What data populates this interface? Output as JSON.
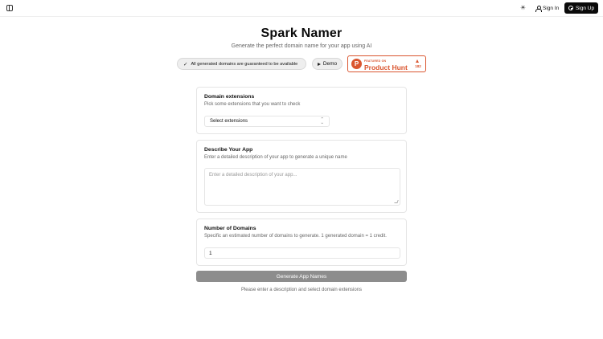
{
  "header": {
    "signin_label": "Sign In",
    "signup_label": "Sign Up",
    "icons": {
      "sidebar": "sidebar-toggle-icon",
      "theme": "sun-icon",
      "user": "user-icon",
      "signup": "plus-circle-icon"
    }
  },
  "hero": {
    "title": "Spark Namer",
    "subtitle": "Generate the perfect domain name for your app using AI"
  },
  "badges": {
    "availability": "All generated domains are guaranteed to be available",
    "demo": "Demo"
  },
  "product_hunt": {
    "logo_letter": "P",
    "featured": "FEATURED ON",
    "name": "Product Hunt",
    "count": "182",
    "color": "#da552f"
  },
  "extensions": {
    "title": "Domain extensions",
    "description": "Pick some extensions that you want to check",
    "select_value": "Select extensions"
  },
  "describe": {
    "title": "Describe Your App",
    "description": "Enter a detailed description of your app to generate a unique name",
    "placeholder": "Enter a detailed description of your app..."
  },
  "domains": {
    "title": "Number of Domains",
    "description": "Specific an estimated number of domains to generate. 1 generated domain = 1 credit.",
    "value": "1"
  },
  "actions": {
    "generate_label": "Generate App Names",
    "hint": "Please enter a description and select domain extensions"
  }
}
